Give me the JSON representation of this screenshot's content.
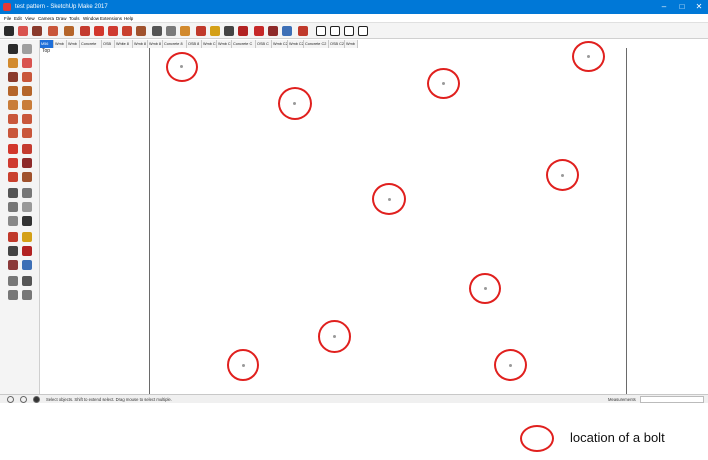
{
  "window": {
    "title": "test pattern - SketchUp Make 2017",
    "minimize_glyph": "–",
    "maximize_glyph": "□",
    "close_glyph": "✕"
  },
  "menu": [
    "File",
    "Edit",
    "View",
    "Camera",
    "Draw",
    "Tools",
    "Window",
    "Extensions",
    "Help"
  ],
  "tags": [
    "M56",
    "Wmb",
    "Wmb",
    "Concrete",
    "OSB",
    "White 8",
    "Wmb 8",
    "Wmb 8",
    "Concrete 8",
    "OSB 8",
    "Wmb C",
    "Wmb C",
    "Concrete C",
    "OSB C",
    "Wmb C2",
    "Wmb C2",
    "Concrete C2",
    "OSB C2",
    "Wmb"
  ],
  "viewport": {
    "view_name": "Top"
  },
  "status": {
    "hint": "Select objects. Shift to extend select. Drag mouse to select multiple.",
    "measurements_label": "Measurements",
    "measurements_value": ""
  },
  "legend": {
    "label": "location of a bolt",
    "marker_color": "#e0201e"
  },
  "colors": {
    "titlebar": "#0078d7",
    "bolt_marker": "#e0201e",
    "active_tag": "#1e6fd9"
  },
  "icons": {
    "toolbar": [
      "select-arrow-icon",
      "eraser-icon",
      "line-pencil-icon",
      "arc-icon",
      "shape-icon",
      "push-pull-icon",
      "move-icon",
      "rotate-icon",
      "scale-icon",
      "offset-icon",
      "tape-measure-icon",
      "text-icon",
      "paint-bucket-icon",
      "orbit-icon",
      "pan-icon",
      "zoom-icon",
      "zoom-extents-icon",
      "warehouse-icon",
      "extension-icon",
      "ruby-icon",
      "layout-icon",
      "view-iso-icon",
      "view-top-icon",
      "view-front-icon",
      "view-right-icon"
    ],
    "status": [
      "geo-location-icon",
      "credits-icon",
      "user-icon"
    ]
  }
}
